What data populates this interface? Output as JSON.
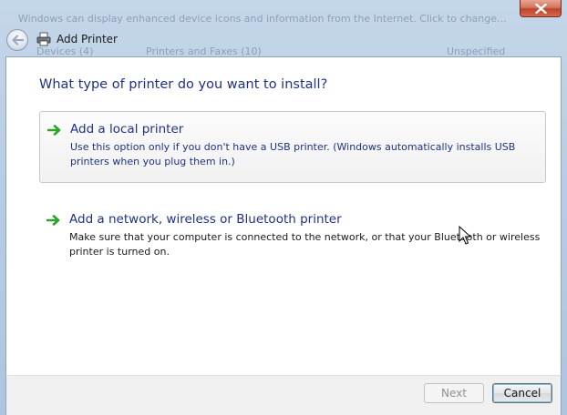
{
  "background_window": {
    "ghost_line_1": "Windows can display enhanced device icons and information from the Internet. Click to change...",
    "ghost_col_1": "Devices (4)",
    "ghost_col_2": "Printers and Faxes (10)",
    "ghost_col_3": "Unspecified"
  },
  "window": {
    "title": "Add Printer",
    "close_icon": "close-icon",
    "back_icon": "back-arrow-icon",
    "title_icon": "printer-icon"
  },
  "page": {
    "heading": "What type of printer do you want to install?"
  },
  "options": [
    {
      "title": "Add a local printer",
      "description": "Use this option only if you don't have a USB printer. (Windows automatically installs USB printers when you plug them in.)",
      "icon": "green-arrow-icon",
      "hovered": true
    },
    {
      "title": "Add a network, wireless or Bluetooth printer",
      "description": "Make sure that your computer is connected to the network, or that your Bluetooth or wireless printer is turned on.",
      "icon": "green-arrow-icon",
      "hovered": false
    }
  ],
  "footer": {
    "next_label": "Next",
    "next_enabled": false,
    "cancel_label": "Cancel"
  },
  "colors": {
    "link_blue": "#1e3287",
    "arrow_green": "#2aa52a",
    "close_red": "#c0432a"
  }
}
